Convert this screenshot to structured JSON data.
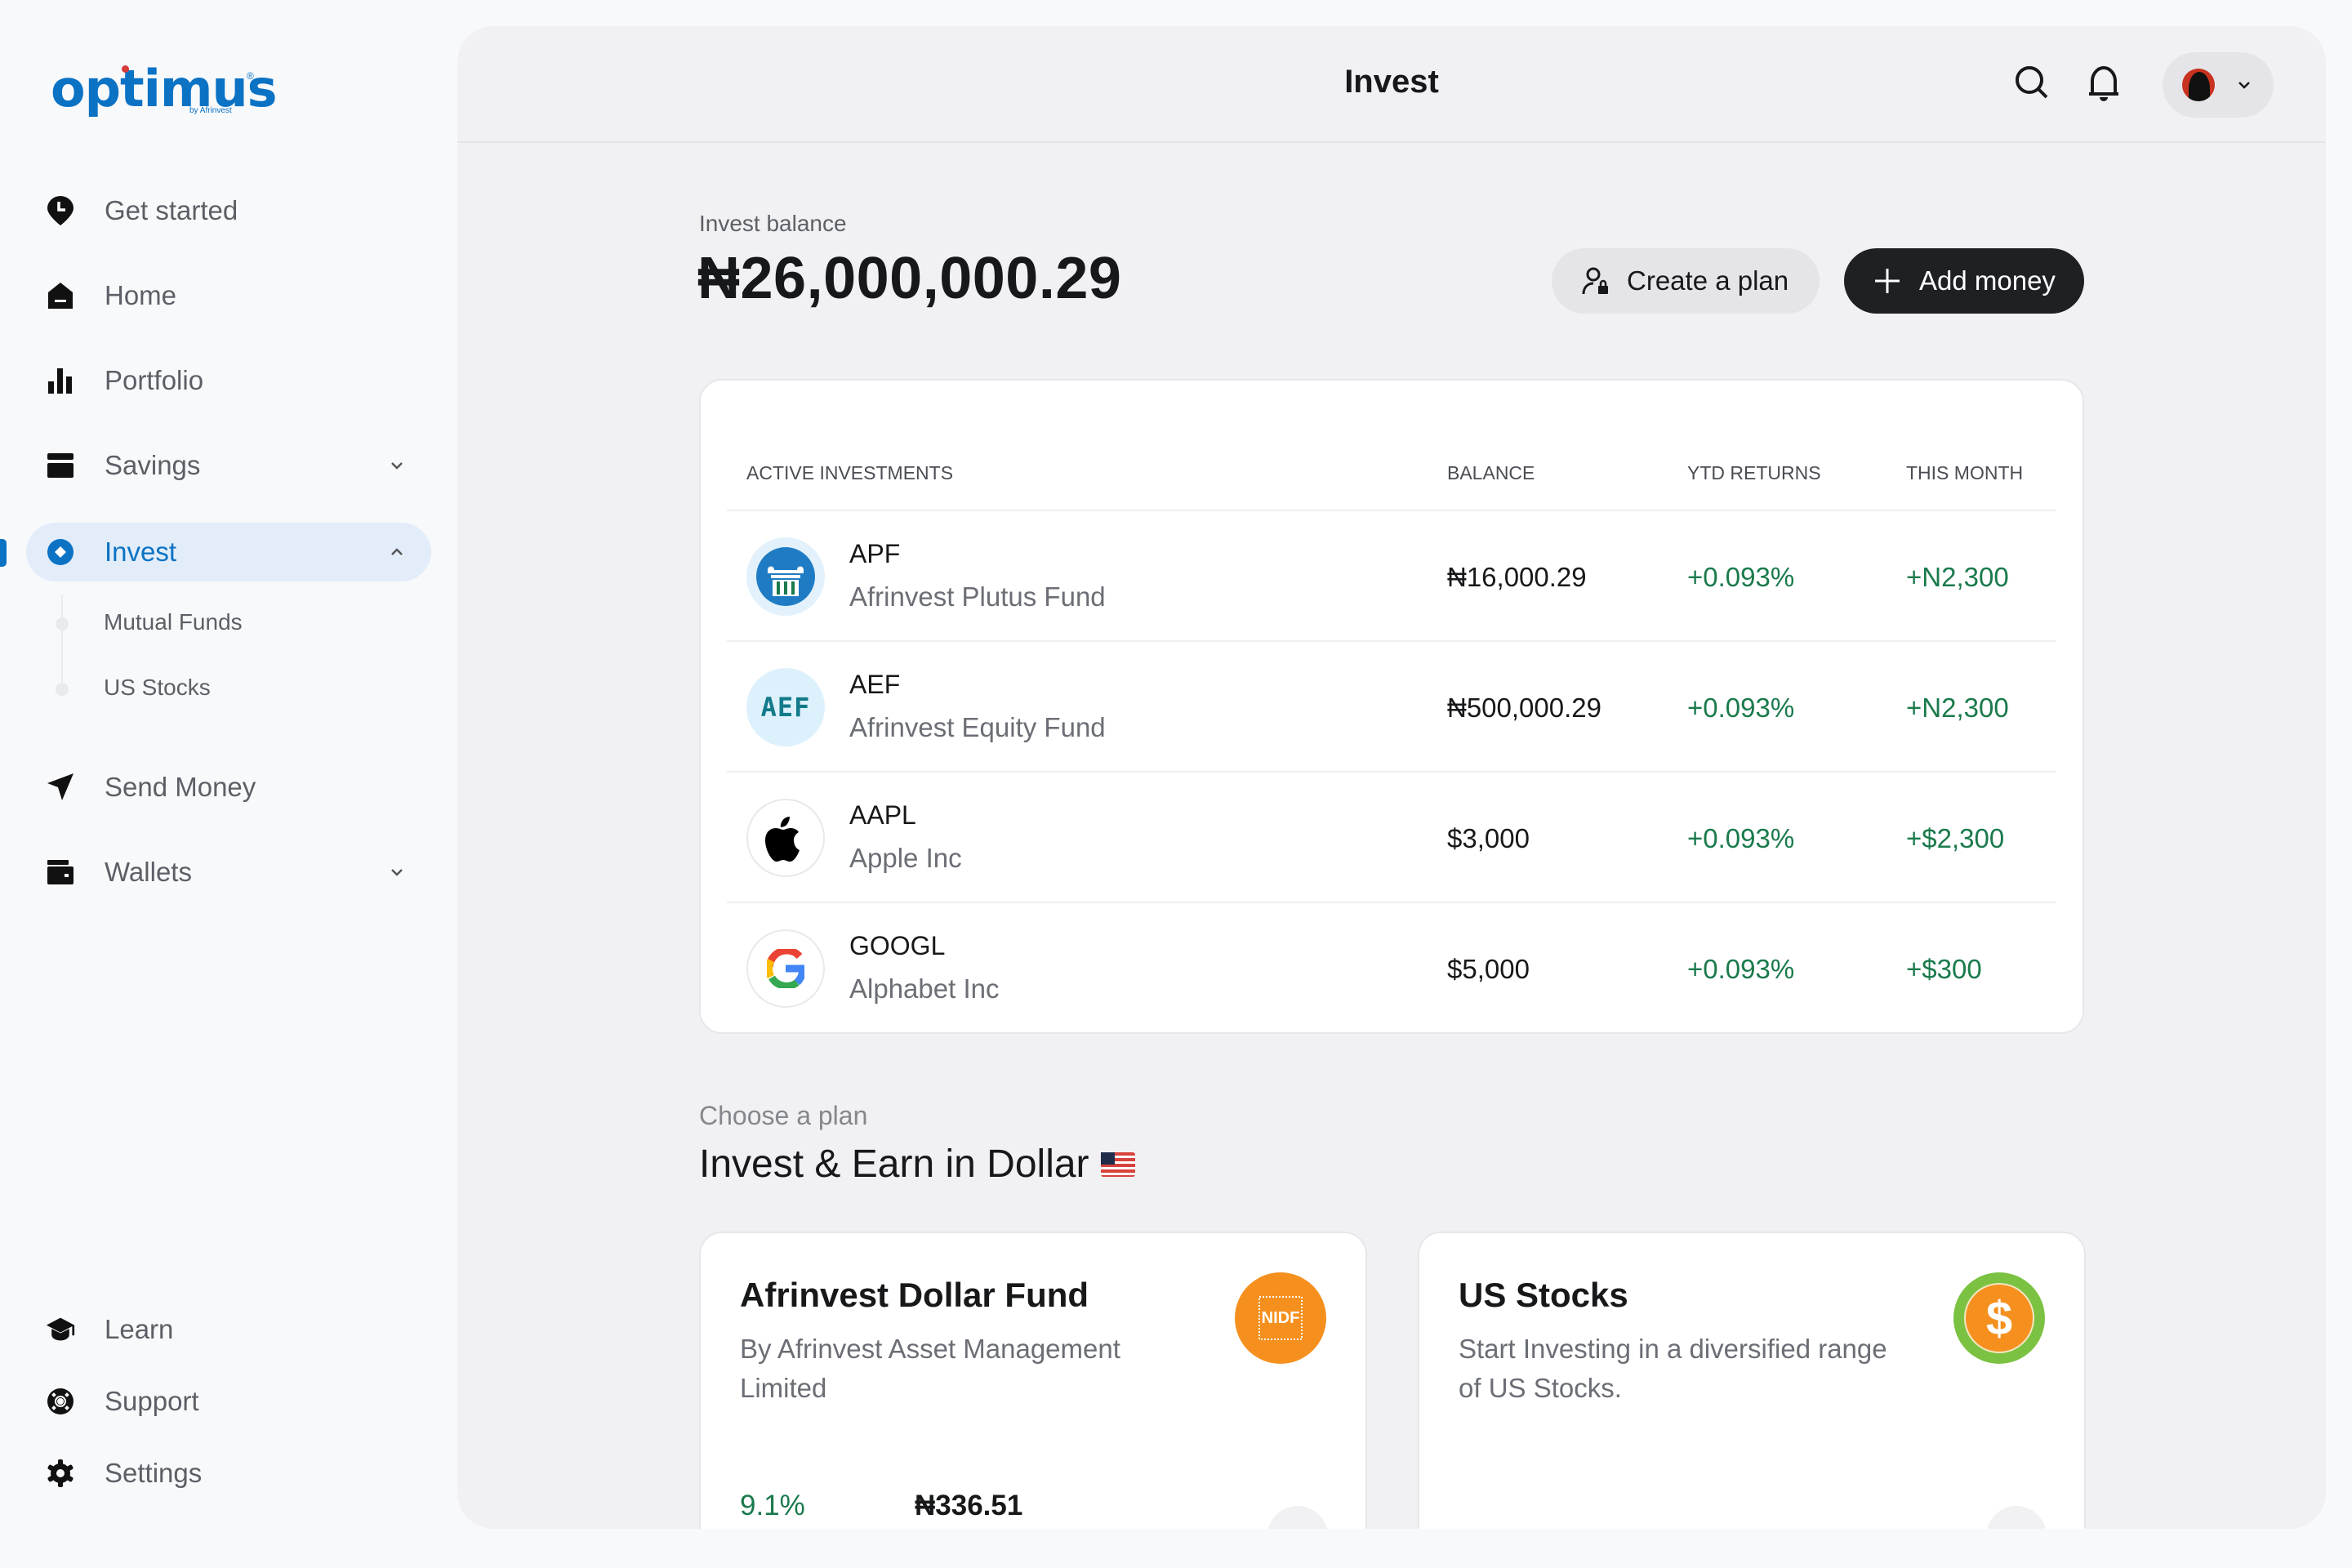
{
  "brand": {
    "name": "optimus",
    "tagline": "by Afrinvest",
    "accent": "#0b72c4"
  },
  "sidebar": {
    "items": [
      {
        "label": "Get started",
        "icon": "location-clock-icon"
      },
      {
        "label": "Home",
        "icon": "home-icon"
      },
      {
        "label": "Portfolio",
        "icon": "bar-chart-icon"
      },
      {
        "label": "Savings",
        "icon": "card-icon",
        "expandable": true
      },
      {
        "label": "Invest",
        "icon": "invest-icon",
        "expandable": true,
        "active": true
      },
      {
        "label": "Send Money",
        "icon": "send-icon"
      },
      {
        "label": "Wallets",
        "icon": "wallet-icon",
        "expandable": true
      }
    ],
    "invest_subitems": [
      {
        "label": "Mutual Funds"
      },
      {
        "label": "US Stocks"
      }
    ],
    "bottom_items": [
      {
        "label": "Learn",
        "icon": "graduation-cap-icon"
      },
      {
        "label": "Support",
        "icon": "lifebuoy-icon"
      },
      {
        "label": "Settings",
        "icon": "gear-icon"
      }
    ]
  },
  "header": {
    "title": "Invest"
  },
  "balance": {
    "label": "Invest balance",
    "value": "₦26,000,000.29",
    "create_plan_label": "Create a plan",
    "add_money_label": "Add money"
  },
  "investments": {
    "columns": [
      "ACTIVE  INVESTMENTS",
      "BALANCE",
      "YTD RETURNS",
      "THIS MONTH"
    ],
    "rows": [
      {
        "ticker": "APF",
        "name": "Afrinvest Plutus Fund",
        "balance": "₦16,000.29",
        "ytd": "+0.093%",
        "month": "+N2,300",
        "logo": "apf-logo"
      },
      {
        "ticker": "AEF",
        "name": "Afrinvest Equity Fund",
        "balance": "₦500,000.29",
        "ytd": "+0.093%",
        "month": "+N2,300",
        "logo": "aef-logo",
        "logo_text": "AEF"
      },
      {
        "ticker": "AAPL",
        "name": "Apple Inc",
        "balance": "$3,000",
        "ytd": "+0.093%",
        "month": "+$2,300",
        "logo": "apple-logo"
      },
      {
        "ticker": "GOOGL",
        "name": "Alphabet Inc",
        "balance": "$5,000",
        "ytd": "+0.093%",
        "month": "+$300",
        "logo": "google-logo"
      }
    ]
  },
  "plans": {
    "eyebrow": "Choose a plan",
    "title": "Invest & Earn in Dollar",
    "cards": [
      {
        "title": "Afrinvest Dollar Fund",
        "description": "By Afrinvest Asset Management Limited",
        "logo_text": "NIDF",
        "return": "9.1%",
        "price": "₦336.51"
      },
      {
        "title": "US Stocks",
        "description": "Start Investing in a diversified range of US Stocks."
      }
    ]
  },
  "colors": {
    "positive": "#1a7a4c",
    "primary_dark": "#1e2023",
    "nidf_orange": "#f5901f",
    "usstocks_green": "#7cc242"
  }
}
